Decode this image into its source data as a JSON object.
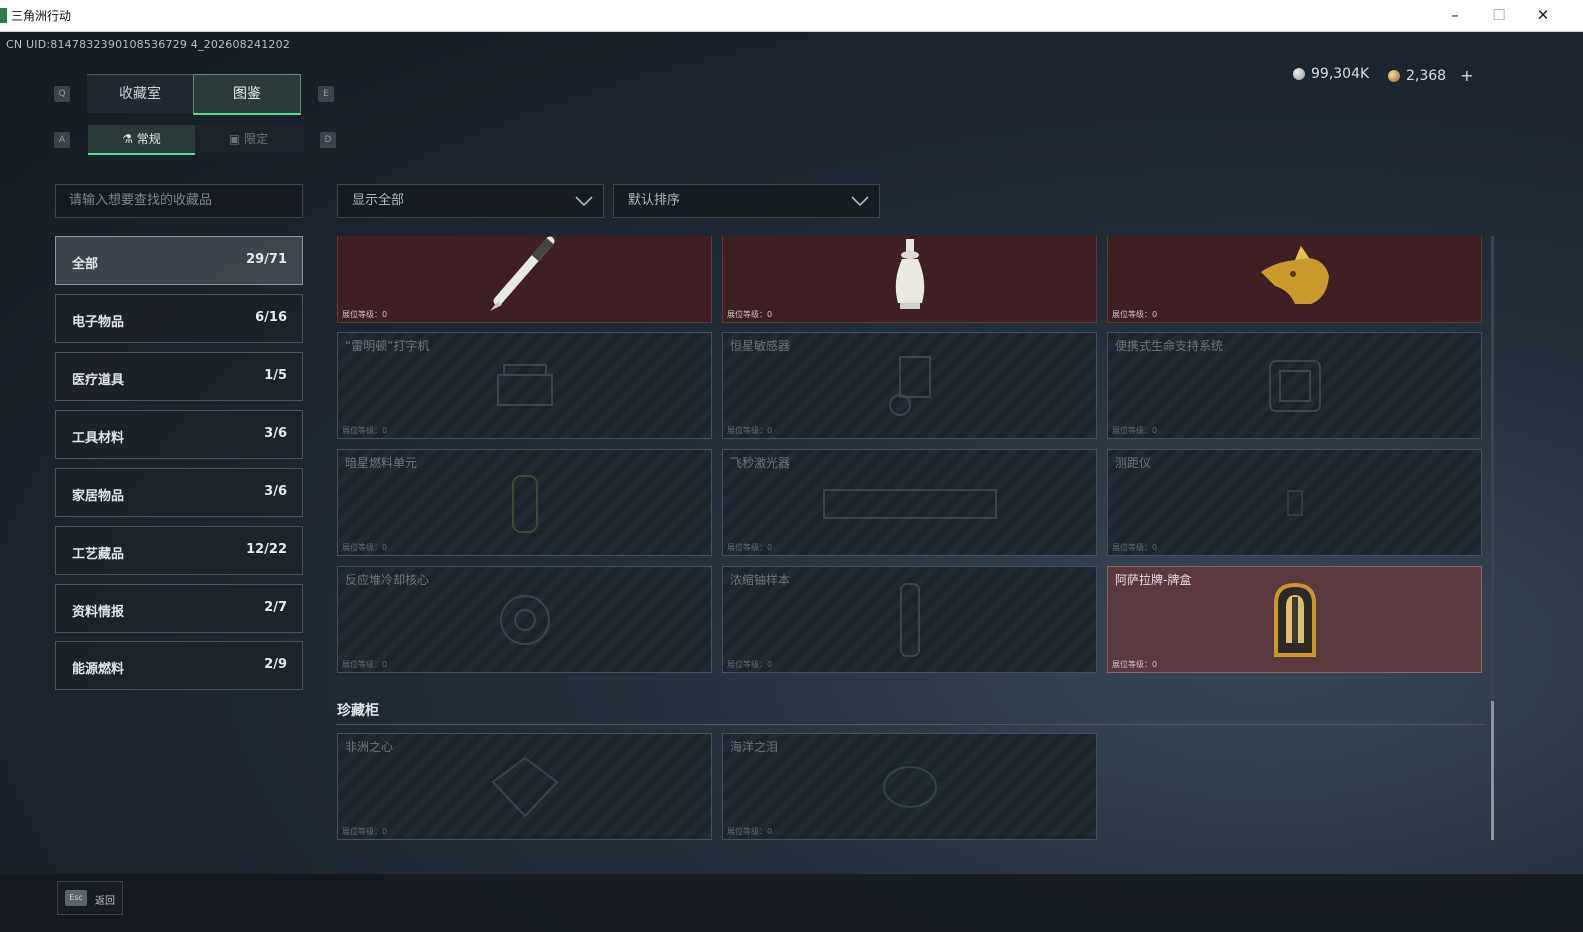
{
  "window": {
    "title": "三角洲行动",
    "minimize": "–",
    "maximize": "☐",
    "close": "✕"
  },
  "uid": "CN UID:8147832390108536729 4_202608241202",
  "currency": {
    "silver": "99,304K",
    "gold": "2,368",
    "add": "+"
  },
  "keys": {
    "q": "Q",
    "e": "E",
    "a": "A",
    "d": "D"
  },
  "tabs": [
    {
      "label": "收藏室"
    },
    {
      "label": "图鉴"
    }
  ],
  "subtabs": [
    {
      "label": "常规"
    },
    {
      "label": "限定"
    }
  ],
  "search": {
    "placeholder": "请输入想要查找的收藏品"
  },
  "filters": {
    "show": "显示全部",
    "sort": "默认排序"
  },
  "categories": [
    {
      "label": "全部",
      "count": "29/71"
    },
    {
      "label": "电子物品",
      "count": "6/16"
    },
    {
      "label": "医疗道具",
      "count": "1/5"
    },
    {
      "label": "工具材料",
      "count": "3/6"
    },
    {
      "label": "家居物品",
      "count": "3/6"
    },
    {
      "label": "工艺藏品",
      "count": "12/22"
    },
    {
      "label": "资料情报",
      "count": "2/7"
    },
    {
      "label": "能源燃料",
      "count": "2/9"
    }
  ],
  "level_label": "展位等级：0",
  "cards": [
    {
      "name": "",
      "icon": "pen-icon"
    },
    {
      "name": "",
      "icon": "vase-icon"
    },
    {
      "name": "",
      "icon": "golden-beast-head-icon"
    },
    {
      "name": "“雷明顿”打字机",
      "icon": "typewriter-icon"
    },
    {
      "name": "恒星敏感器",
      "icon": "sensor-icon"
    },
    {
      "name": "便携式生命支持系统",
      "icon": "life-support-icon"
    },
    {
      "name": "暗星燃料单元",
      "icon": "fuel-cell-icon"
    },
    {
      "name": "飞秒激光器",
      "icon": "laser-icon"
    },
    {
      "name": "测距仪",
      "icon": "rangefinder-icon"
    },
    {
      "name": "反应堆冷却核心",
      "icon": "reactor-core-icon"
    },
    {
      "name": "浓缩铀样本",
      "icon": "uranium-sample-icon"
    },
    {
      "name": "阿萨拉牌-牌盒",
      "icon": "card-box-icon"
    }
  ],
  "section": {
    "title": "珍藏柜"
  },
  "vault_cards": [
    {
      "name": "非洲之心",
      "icon": "diamond-icon"
    },
    {
      "name": "海洋之泪",
      "icon": "gem-icon"
    }
  ],
  "footer": {
    "esc": "Esc",
    "back": "返回"
  }
}
